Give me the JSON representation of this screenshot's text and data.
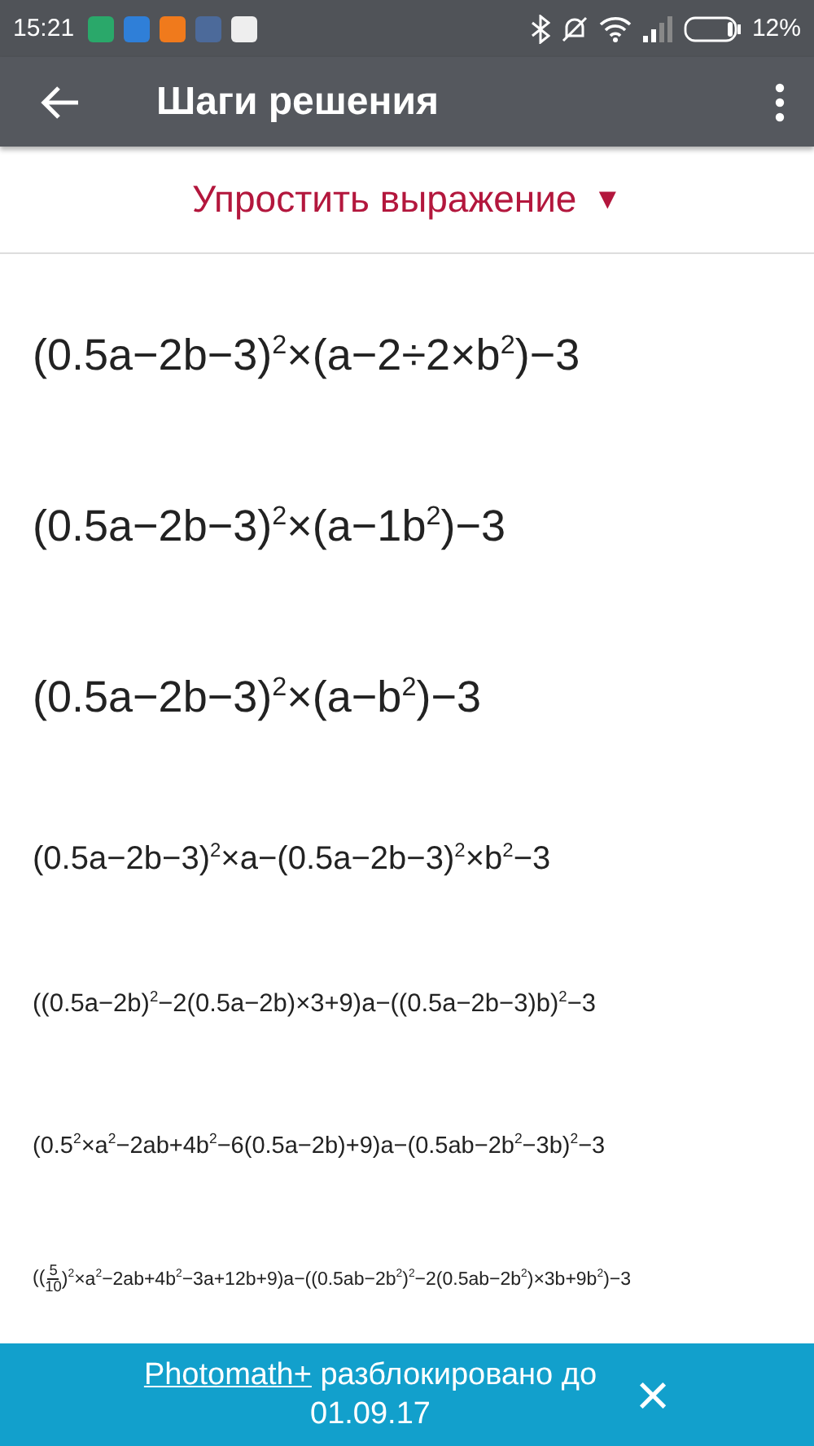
{
  "status_bar": {
    "time": "15:21",
    "battery": "12%"
  },
  "app_bar": {
    "title": "Шаги решения"
  },
  "method": {
    "label": "Упростить выражение",
    "caret": "▼"
  },
  "steps": [
    {
      "segments": [
        {
          "kind": "text",
          "text": "(0.5a−2b−3)$^{2}$×(a−2÷2×b$^{2}$)−3"
        }
      ]
    },
    {
      "segments": [
        {
          "kind": "text",
          "text": "(0.5a−2b−3)$^{2}$×(a−1b$^{2}$)−3"
        }
      ]
    },
    {
      "segments": [
        {
          "kind": "text",
          "text": "(0.5a−2b−3)$^{2}$×(a−b$^{2}$)−3"
        }
      ]
    },
    {
      "segments": [
        {
          "kind": "text",
          "text": "(0.5a−2b−3)$^{2}$×a−(0.5a−2b−3)$^{2}$×b$^{2}$−3"
        }
      ]
    },
    {
      "segments": [
        {
          "kind": "text",
          "text": "((0.5a−2b)$^{2}$−2(0.5a−2b)×3+9)a−((0.5a−2b−3)b)$^{2}$−3"
        }
      ]
    },
    {
      "segments": [
        {
          "kind": "text",
          "text": "(0.5$^{2}$×a$^{2}$−2ab+4b$^{2}$−6(0.5a−2b)+9)a−(0.5ab−2b$^{2}$−3b)$^{2}$−3"
        }
      ]
    },
    {
      "segments": [
        {
          "kind": "text",
          "text": "(("
        },
        {
          "kind": "fraction",
          "numerator": "5",
          "denominator": "10"
        },
        {
          "kind": "text",
          "text": ")$^{2}$×a$^{2}$−2ab+4b$^{2}$−3a+12b+9)a−((0.5ab−2b$^{2}$)$^{2}$−2(0.5ab−2b$^{2}$)×3b+9b$^{2}$)−3"
        }
      ]
    }
  ],
  "banner": {
    "link": "Photomath+",
    "text": "разблокировано до",
    "date": "01.09.17",
    "close": "×"
  }
}
